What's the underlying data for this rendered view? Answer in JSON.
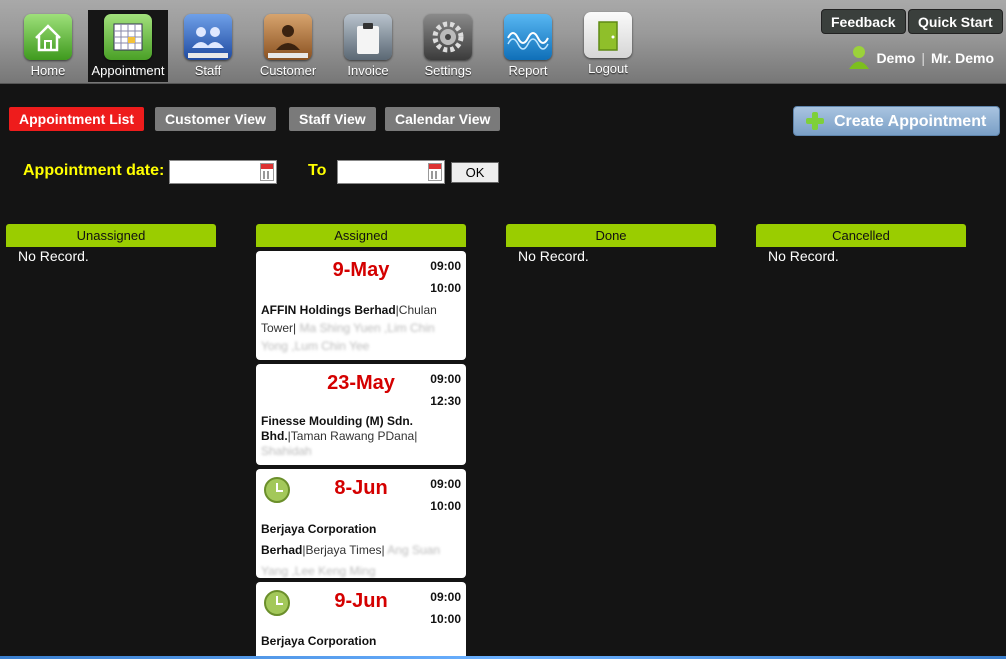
{
  "nav": {
    "items": [
      {
        "label": "Home",
        "icon": "home-icon"
      },
      {
        "label": "Appointment",
        "icon": "appointment-icon"
      },
      {
        "label": "Staff",
        "icon": "staff-icon"
      },
      {
        "label": "Customer",
        "icon": "customer-icon"
      },
      {
        "label": "Invoice",
        "icon": "invoice-icon"
      },
      {
        "label": "Settings",
        "icon": "settings-icon"
      },
      {
        "label": "Report",
        "icon": "report-icon"
      },
      {
        "label": "Logout",
        "icon": "logout-icon"
      }
    ],
    "active": "Appointment"
  },
  "header": {
    "feedback_label": "Feedback",
    "quick_start_label": "Quick Start",
    "user_name": "Demo",
    "user_title": "Mr. Demo"
  },
  "tabs": [
    {
      "label": "Appointment List",
      "active": true
    },
    {
      "label": "Customer View",
      "active": false
    },
    {
      "label": "Staff View",
      "active": false
    },
    {
      "label": "Calendar View",
      "active": false
    }
  ],
  "create_button": {
    "label": "Create Appointment"
  },
  "filter": {
    "date_label": "Appointment date:",
    "to_label": "To",
    "from_value": "",
    "to_value": "",
    "ok_label": "OK"
  },
  "columns": [
    {
      "title": "Unassigned",
      "empty_text": "No Record."
    },
    {
      "title": "Assigned",
      "empty_text": ""
    },
    {
      "title": "Done",
      "empty_text": "No Record."
    },
    {
      "title": "Cancelled",
      "empty_text": "No Record."
    }
  ],
  "appointments": [
    {
      "date": "9-May",
      "start": "09:00",
      "end": "10:00",
      "name": "AFFIN Holdings Berhad",
      "location": "Chulan Tower",
      "staff": "Ma Shing Yuen ,Lim Chin Yong ,Lum Chin Yee",
      "clock": false
    },
    {
      "date": "23-May",
      "start": "09:00",
      "end": "12:30",
      "name": "Finesse Moulding (M) Sdn. Bhd.",
      "location": "Taman Rawang PDana",
      "staff": "Shahidah",
      "clock": false
    },
    {
      "date": "8-Jun",
      "start": "09:00",
      "end": "10:00",
      "name": "Berjaya Corporation Berhad",
      "location": "Berjaya Times",
      "staff": "Ang Suan Yang ,Lee Keng Ming",
      "clock": true
    },
    {
      "date": "9-Jun",
      "start": "09:00",
      "end": "10:00",
      "name": "Berjaya Corporation",
      "location": "",
      "staff": "",
      "clock": true
    }
  ]
}
